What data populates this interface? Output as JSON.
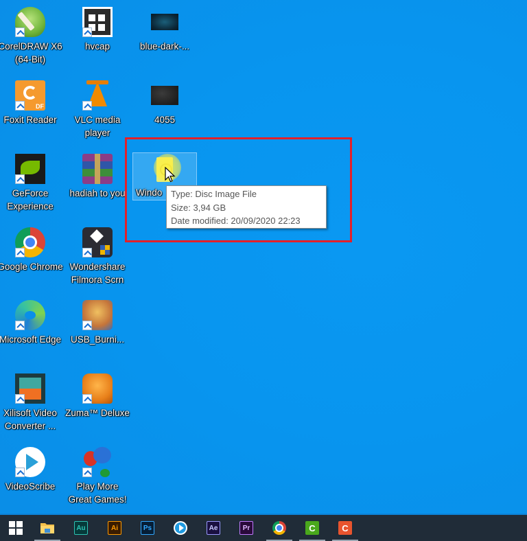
{
  "desktop": {
    "background_color": "#0a96f0",
    "icons": [
      {
        "label": "CorelDRAW X6 (64-Bit)",
        "icon": "coreldraw-icon",
        "shortcut": true
      },
      {
        "label": "hvcap",
        "icon": "hvcap-icon",
        "shortcut": true
      },
      {
        "label": "blue-dark-...",
        "icon": "image-thumbnail-icon",
        "shortcut": false
      },
      {
        "label": "Foxit Reader",
        "icon": "foxit-reader-icon",
        "shortcut": true
      },
      {
        "label": "VLC media player",
        "icon": "vlc-icon",
        "shortcut": true
      },
      {
        "label": "4055",
        "icon": "image-thumbnail-icon",
        "shortcut": false
      },
      {
        "label": "GeForce Experience",
        "icon": "nvidia-geforce-icon",
        "shortcut": true
      },
      {
        "label": "hadiah to you",
        "icon": "winrar-archive-icon",
        "shortcut": false
      },
      {
        "label": "Windo",
        "icon": "disc-image-file-icon",
        "shortcut": false,
        "selected": true
      },
      {
        "label": "Google Chrome",
        "icon": "chrome-icon",
        "shortcut": true
      },
      {
        "label": "Wondershare Filmora Scrn",
        "icon": "filmora-scrn-icon",
        "shortcut": true
      },
      {
        "label": "Microsoft Edge",
        "icon": "edge-icon",
        "shortcut": true
      },
      {
        "label": "USB_Burni...",
        "icon": "usb-burning-tool-icon",
        "shortcut": true
      },
      {
        "label": "Xilisoft Video Converter ...",
        "icon": "xilisoft-video-converter-icon",
        "shortcut": true
      },
      {
        "label": "Zuma™ Deluxe",
        "icon": "zuma-deluxe-icon",
        "shortcut": true
      },
      {
        "label": "VideoScribe",
        "icon": "videoscribe-icon",
        "shortcut": true
      },
      {
        "label": "Play More Great Games!",
        "icon": "games-icon",
        "shortcut": true
      }
    ]
  },
  "tooltip": {
    "type": "Type: Disc Image File",
    "size": "Size: 3,94 GB",
    "date_modified": "Date modified: 20/09/2020 22:23"
  },
  "annotation": {
    "color": "#e3202a"
  },
  "taskbar": {
    "items": [
      {
        "name": "start",
        "label": ""
      },
      {
        "name": "file-explorer",
        "label": ""
      },
      {
        "name": "audition",
        "label": "Au"
      },
      {
        "name": "illustrator",
        "label": "Ai"
      },
      {
        "name": "photoshop",
        "label": "Ps"
      },
      {
        "name": "media-player",
        "label": ""
      },
      {
        "name": "after-effects",
        "label": "Ae"
      },
      {
        "name": "premiere-pro",
        "label": "Pr"
      },
      {
        "name": "chrome",
        "label": ""
      },
      {
        "name": "camtasia-green",
        "label": "C"
      },
      {
        "name": "camtasia-orange",
        "label": "C"
      }
    ]
  }
}
